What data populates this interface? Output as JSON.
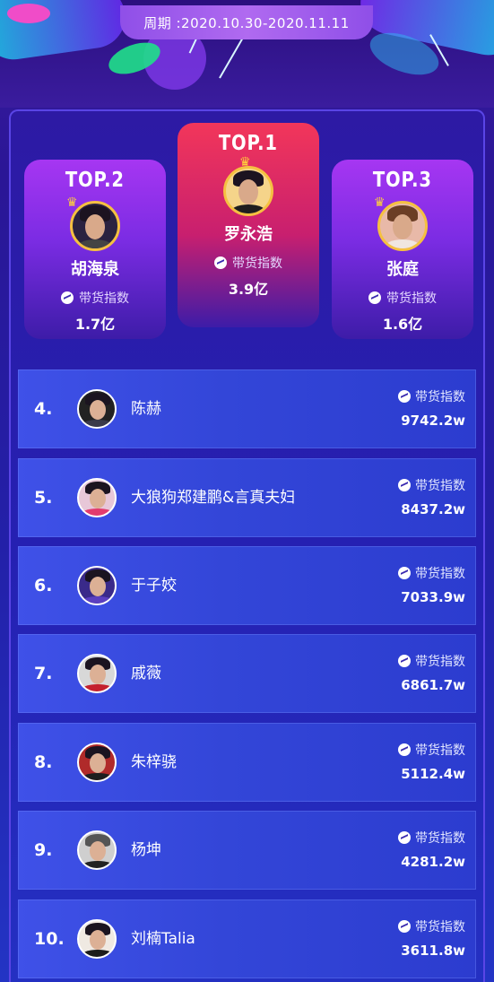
{
  "period": "周期 :2020.10.30-2020.11.11",
  "metric_label": "带货指数",
  "podium": [
    {
      "rank_title": "TOP.2",
      "name": "胡海泉",
      "value": "1.7亿"
    },
    {
      "rank_title": "TOP.1",
      "name": "罗永浩",
      "value": "3.9亿"
    },
    {
      "rank_title": "TOP.3",
      "name": "张庭",
      "value": "1.6亿"
    }
  ],
  "list": [
    {
      "rank": "4.",
      "name": "陈赫",
      "value": "9742.2w"
    },
    {
      "rank": "5.",
      "name": "大狼狗郑建鹏&言真夫妇",
      "value": "8437.2w"
    },
    {
      "rank": "6.",
      "name": "于子姣",
      "value": "7033.9w"
    },
    {
      "rank": "7.",
      "name": "戚薇",
      "value": "6861.7w"
    },
    {
      "rank": "8.",
      "name": "朱梓骁",
      "value": "5112.4w"
    },
    {
      "rank": "9.",
      "name": "杨坤",
      "value": "4281.2w"
    },
    {
      "rank": "10.",
      "name": "刘楠Talia",
      "value": "3611.8w"
    }
  ],
  "colors": {
    "background": "#2a1d9e",
    "top1_card": "#f2365a",
    "side_card": "#a636f2",
    "row": "#3f51e8",
    "avatar_ring": "#f5c041"
  },
  "icons": {
    "metric": "trend-icon",
    "crown": "crown-icon"
  }
}
